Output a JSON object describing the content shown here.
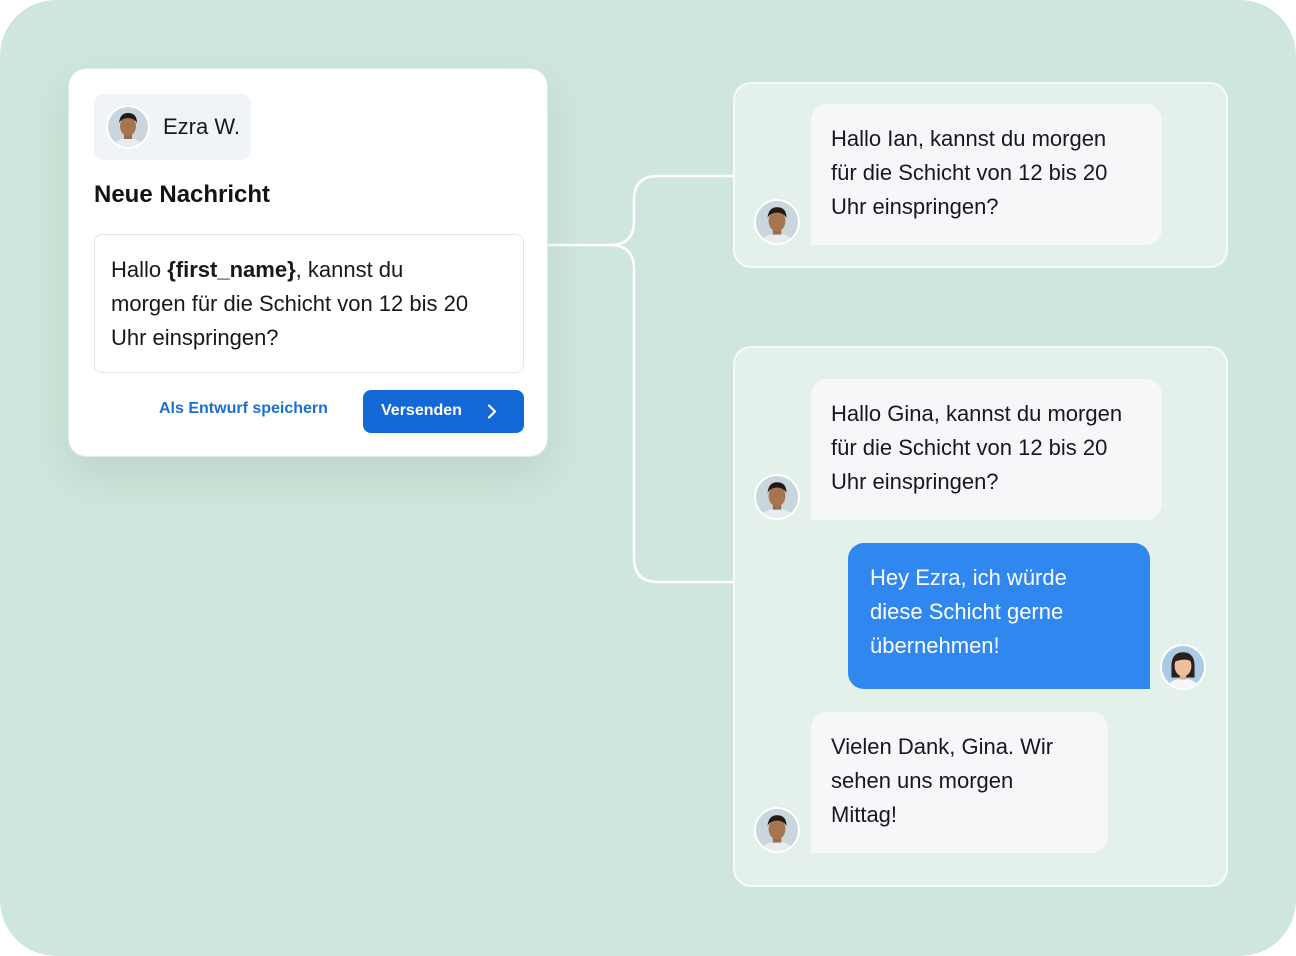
{
  "compose": {
    "sender_name": "Ezra W.",
    "title": "Neue Nachricht",
    "template": {
      "prefix": "Hallo ",
      "placeholder_token": "{first_name}",
      "suffix_line1": ", kannst du",
      "line2": "morgen für die Schicht von 12 bis 20",
      "line3": "Uhr einspringen?"
    },
    "draft_label": "Als Entwurf speichern",
    "send_label": "Versenden"
  },
  "conversations": [
    {
      "messages": [
        {
          "direction": "incoming",
          "sender": "Ezra",
          "lines": [
            "Hallo Ian, kannst du morgen",
            "für die Schicht von 12 bis 20",
            "Uhr einspringen?"
          ]
        }
      ]
    },
    {
      "messages": [
        {
          "direction": "incoming",
          "sender": "Ezra",
          "lines": [
            "Hallo Gina, kannst du morgen",
            "für die Schicht von 12 bis 20",
            "Uhr einspringen?"
          ]
        },
        {
          "direction": "outgoing",
          "sender": "Gina",
          "lines": [
            "Hey Ezra, ich würde",
            "diese Schicht gerne",
            "übernehmen!"
          ]
        },
        {
          "direction": "incoming",
          "sender": "Ezra",
          "lines": [
            "Vielen Dank, Gina. Wir",
            "sehen uns morgen",
            "Mittag!"
          ]
        }
      ]
    }
  ],
  "colors": {
    "background": "#cfe6dc",
    "panel": "#e4f0ea",
    "primary_button": "#1368d8",
    "outgoing_bubble": "#2f87ef",
    "link": "#1a6fd1"
  }
}
